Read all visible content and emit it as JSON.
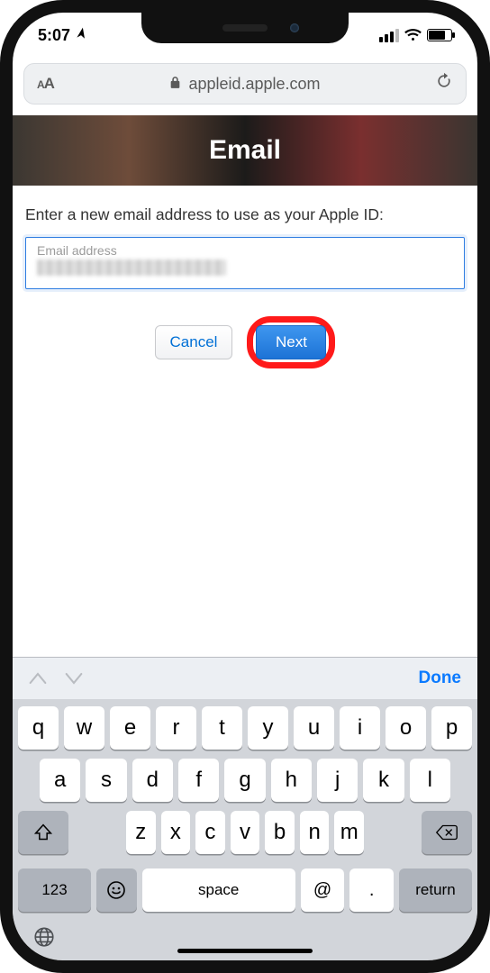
{
  "status": {
    "time": "5:07",
    "location_glyph": "➤"
  },
  "safari": {
    "domain": "appleid.apple.com"
  },
  "banner": {
    "title": "Email"
  },
  "form": {
    "prompt": "Enter a new email address to use as your Apple ID:",
    "field_label": "Email address",
    "cancel": "Cancel",
    "next": "Next"
  },
  "keyboard": {
    "done": "Done",
    "row1": [
      "q",
      "w",
      "e",
      "r",
      "t",
      "y",
      "u",
      "i",
      "o",
      "p"
    ],
    "row2": [
      "a",
      "s",
      "d",
      "f",
      "g",
      "h",
      "j",
      "k",
      "l"
    ],
    "row3": [
      "z",
      "x",
      "c",
      "v",
      "b",
      "n",
      "m"
    ],
    "numbers": "123",
    "space": "space",
    "at": "@",
    "dot": ".",
    "return": "return"
  }
}
